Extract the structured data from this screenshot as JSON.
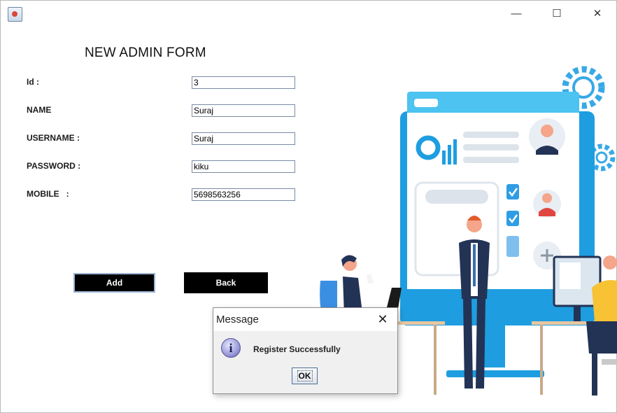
{
  "window": {
    "minimize_glyph": "—",
    "maximize_glyph": "☐",
    "close_glyph": "✕"
  },
  "form": {
    "title": "NEW ADMIN FORM",
    "fields": [
      {
        "label": "Id :",
        "value": "3"
      },
      {
        "label": "NAME",
        "value": "Suraj"
      },
      {
        "label": "USERNAME :",
        "value": "Suraj"
      },
      {
        "label": "PASSWORD :",
        "value": "kiku"
      },
      {
        "label": "MOBILE   :",
        "value": "5698563256"
      }
    ],
    "add_label": "Add",
    "back_label": "Back"
  },
  "dialog": {
    "title": "Message",
    "close_glyph": "✕",
    "icon_glyph": "i",
    "message": "Register Successfully",
    "ok_label": "OK"
  },
  "colors": {
    "accent_blue": "#1a9fe0",
    "button_black": "#000000",
    "dialog_bg": "#f0f0f0"
  },
  "illustration": {
    "icons": [
      "donut-chart-icon",
      "bar-chart-icon",
      "checkbox-icon",
      "plus-icon",
      "gear-icon"
    ]
  }
}
